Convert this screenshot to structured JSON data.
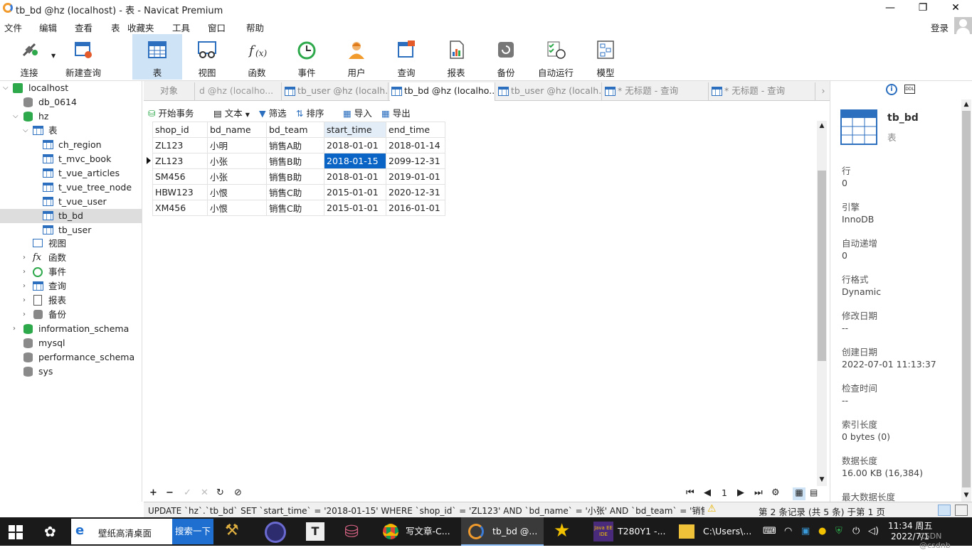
{
  "window": {
    "title": "tb_bd @hz (localhost) - 表 - Navicat Premium",
    "min": "—",
    "max": "❐",
    "close": "✕"
  },
  "menu": [
    "文件",
    "编辑",
    "查看",
    "表",
    "收藏夹",
    "工具",
    "窗口",
    "帮助"
  ],
  "login": "登录",
  "toolbar": [
    {
      "label": "连接",
      "icon": "connection-icon"
    },
    {
      "label": "新建查询",
      "icon": "new-query-icon"
    },
    {
      "label": "表",
      "icon": "table-icon"
    },
    {
      "label": "视图",
      "icon": "view-icon"
    },
    {
      "label": "函数",
      "icon": "function-icon"
    },
    {
      "label": "事件",
      "icon": "event-clock-icon"
    },
    {
      "label": "用户",
      "icon": "user-icon"
    },
    {
      "label": "查询",
      "icon": "query-icon"
    },
    {
      "label": "报表",
      "icon": "report-icon"
    },
    {
      "label": "备份",
      "icon": "backup-icon"
    },
    {
      "label": "自动运行",
      "icon": "automation-icon"
    },
    {
      "label": "模型",
      "icon": "model-icon"
    }
  ],
  "tree": {
    "localhost": "localhost",
    "db_0614": "db_0614",
    "hz": "hz",
    "tables_folder": "表",
    "tables": [
      "ch_region",
      "t_mvc_book",
      "t_vue_articles",
      "t_vue_tree_node",
      "t_vue_user",
      "tb_bd",
      "tb_user"
    ],
    "views": "视图",
    "functions": "函数",
    "events": "事件",
    "queries": "查询",
    "reports": "报表",
    "backups": "备份",
    "other_dbs": [
      "information_schema",
      "mysql",
      "performance_schema",
      "sys"
    ]
  },
  "tabs": [
    "对象",
    "d @hz (localho...",
    "tb_user @hz (localh...",
    "tb_bd @hz (localho...",
    "tb_user @hz (localh...",
    "* 无标题 - 查询",
    "* 无标题 - 查询"
  ],
  "grid_tools": {
    "begin_tx": "开始事务",
    "text": "文本",
    "filter": "筛选",
    "sort": "排序",
    "import": "导入",
    "export": "导出"
  },
  "columns": [
    "shop_id",
    "bd_name",
    "bd_team",
    "start_time",
    "end_time"
  ],
  "rows": [
    [
      "ZL123",
      "小明",
      "销售A助",
      "2018-01-01",
      "2018-01-14"
    ],
    [
      "ZL123",
      "小张",
      "销售B助",
      "2018-01-15",
      "2099-12-31"
    ],
    [
      "SM456",
      "小张",
      "销售B助",
      "2018-01-01",
      "2019-01-01"
    ],
    [
      "HBW123",
      "小恨",
      "销售C助",
      "2015-01-01",
      "2020-12-31"
    ],
    [
      "XM456",
      "小恨",
      "销售C助",
      "2015-01-01",
      "2016-01-01"
    ]
  ],
  "page_number": "1",
  "status": {
    "sql": "UPDATE `hz`.`tb_bd` SET `start_time` = '2018-01-15' WHERE `shop_id` = 'ZL123' AND `bd_name` = '小张' AND `bd_team` = '销售B助' AN",
    "records": "第 2 条记录 (共 5 条) 于第 1 页"
  },
  "info_panel": {
    "title": "tb_bd",
    "subtitle": "表",
    "fields": [
      {
        "k": "行",
        "v": "0"
      },
      {
        "k": "引擎",
        "v": "InnoDB"
      },
      {
        "k": "自动递增",
        "v": "0"
      },
      {
        "k": "行格式",
        "v": "Dynamic"
      },
      {
        "k": "修改日期",
        "v": "--"
      },
      {
        "k": "创建日期",
        "v": "2022-07-01 11:13:37"
      },
      {
        "k": "检查时间",
        "v": "--"
      },
      {
        "k": "索引长度",
        "v": "0 bytes (0)"
      },
      {
        "k": "数据长度",
        "v": "16.00 KB (16,384)"
      },
      {
        "k": "最大数据长度",
        "v": ""
      }
    ]
  },
  "taskbar": {
    "search_hint": "壁纸高清桌面",
    "search_button": "搜索一下",
    "apps": [
      "写文章-C...",
      "tb_bd @...",
      "T280Y1 -...",
      "C:\\Users\\..."
    ],
    "time": "11:34 周五",
    "date": "2022/7/1",
    "watermark": "CSDN @csdnb"
  }
}
